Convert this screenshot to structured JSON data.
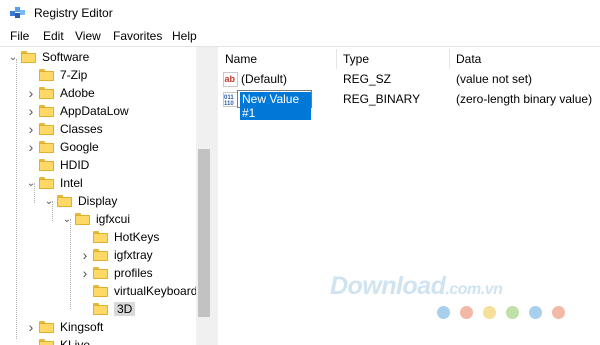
{
  "window": {
    "title": "Registry Editor",
    "app_icon": "registry-editor-icon"
  },
  "menu": [
    "File",
    "Edit",
    "View",
    "Favorites",
    "Help"
  ],
  "tree": {
    "items": [
      {
        "label": "Software",
        "arrow": "open"
      },
      {
        "label": "7-Zip",
        "arrow": "none"
      },
      {
        "label": "Adobe",
        "arrow": "closed"
      },
      {
        "label": "AppDataLow",
        "arrow": "closed"
      },
      {
        "label": "Classes",
        "arrow": "closed"
      },
      {
        "label": "Google",
        "arrow": "closed"
      },
      {
        "label": "HDID",
        "arrow": "none"
      },
      {
        "label": "Intel",
        "arrow": "open"
      },
      {
        "label": "Display",
        "arrow": "open"
      },
      {
        "label": "igfxcui",
        "arrow": "open"
      },
      {
        "label": "HotKeys",
        "arrow": "none"
      },
      {
        "label": "igfxtray",
        "arrow": "closed"
      },
      {
        "label": "profiles",
        "arrow": "closed"
      },
      {
        "label": "virtualKeyboard",
        "arrow": "none"
      },
      {
        "label": "3D",
        "arrow": "none",
        "selected": true
      },
      {
        "label": "Kingsoft",
        "arrow": "closed"
      },
      {
        "label": "KLive",
        "arrow": "none"
      }
    ]
  },
  "list": {
    "columns": [
      "Name",
      "Type",
      "Data"
    ],
    "rows": [
      {
        "name": "(Default)",
        "type": "REG_SZ",
        "data": "(value not set)",
        "icon": "string-value-icon"
      },
      {
        "name": "New Value #1",
        "type": "REG_BINARY",
        "data": "(zero-length binary value)",
        "icon": "binary-value-icon",
        "editing": true
      }
    ]
  },
  "watermark": {
    "text": "Download",
    "suffix": ".com.vn"
  },
  "colors": {
    "selection": "#0078d7",
    "folder": "#ffd866",
    "watermark": "#cfe3f1"
  }
}
